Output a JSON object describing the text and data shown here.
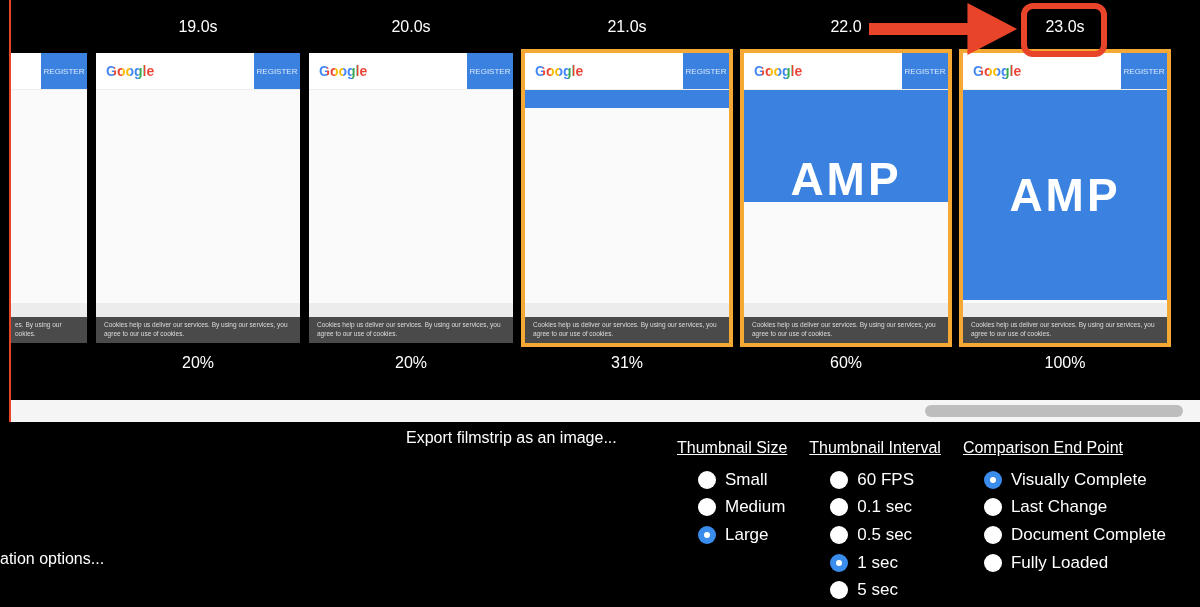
{
  "filmstrip": {
    "frames": [
      {
        "register": "REGISTER",
        "kind": "blank",
        "cookie_text": "es. By using our ookies.",
        "highlighted": false,
        "circled": false,
        "partial": true
      },
      {
        "time": "19.0s",
        "logo": "Google",
        "register": "REGISTER",
        "kind": "blank",
        "cookie_text": "Cookies help us deliver our services. By using our services, you agree to our use of cookies.",
        "percent": "20%",
        "highlighted": false,
        "circled": false,
        "partial": false
      },
      {
        "time": "20.0s",
        "logo": "Google",
        "register": "REGISTER",
        "kind": "blank",
        "cookie_text": "Cookies help us deliver our services. By using our services, you agree to our use of cookies.",
        "percent": "20%",
        "highlighted": false,
        "circled": false,
        "partial": false
      },
      {
        "time": "21.0s",
        "logo": "Google",
        "register": "REGISTER",
        "kind": "band",
        "cookie_text": "Cookies help us deliver our services. By using our services, you agree to our use of cookies.",
        "percent": "31%",
        "highlighted": true,
        "circled": false,
        "partial": false
      },
      {
        "time": "22.0",
        "logo": "Google",
        "register": "REGISTER",
        "kind": "hero-partial",
        "hero_text": "AMP",
        "cookie_text": "Cookies help us deliver our services. By using our services, you agree to our use of cookies.",
        "percent": "60%",
        "highlighted": true,
        "circled": false,
        "partial": false
      },
      {
        "time": "23.0s",
        "logo": "Google",
        "register": "REGISTER",
        "kind": "hero-full",
        "hero_text": "AMP",
        "cookie_text": "Cookies help us deliver our services. By using our services, you agree to our use of cookies.",
        "percent": "100%",
        "highlighted": true,
        "circled": true,
        "partial": false
      }
    ]
  },
  "export_link": "Export filmstrip as an image...",
  "options_link": "ation options...",
  "groups": [
    {
      "title": "Thumbnail Size",
      "options": [
        {
          "label": "Small",
          "selected": false
        },
        {
          "label": "Medium",
          "selected": false
        },
        {
          "label": "Large",
          "selected": true
        }
      ]
    },
    {
      "title": "Thumbnail Interval",
      "options": [
        {
          "label": "60 FPS",
          "selected": false
        },
        {
          "label": "0.1 sec",
          "selected": false
        },
        {
          "label": "0.5 sec",
          "selected": false
        },
        {
          "label": "1 sec",
          "selected": true
        },
        {
          "label": "5 sec",
          "selected": false
        }
      ]
    },
    {
      "title": "Comparison End Point",
      "options": [
        {
          "label": "Visually Complete",
          "selected": true
        },
        {
          "label": "Last Change",
          "selected": false
        },
        {
          "label": "Document Complete",
          "selected": false
        },
        {
          "label": "Fully Loaded",
          "selected": false
        }
      ]
    }
  ]
}
